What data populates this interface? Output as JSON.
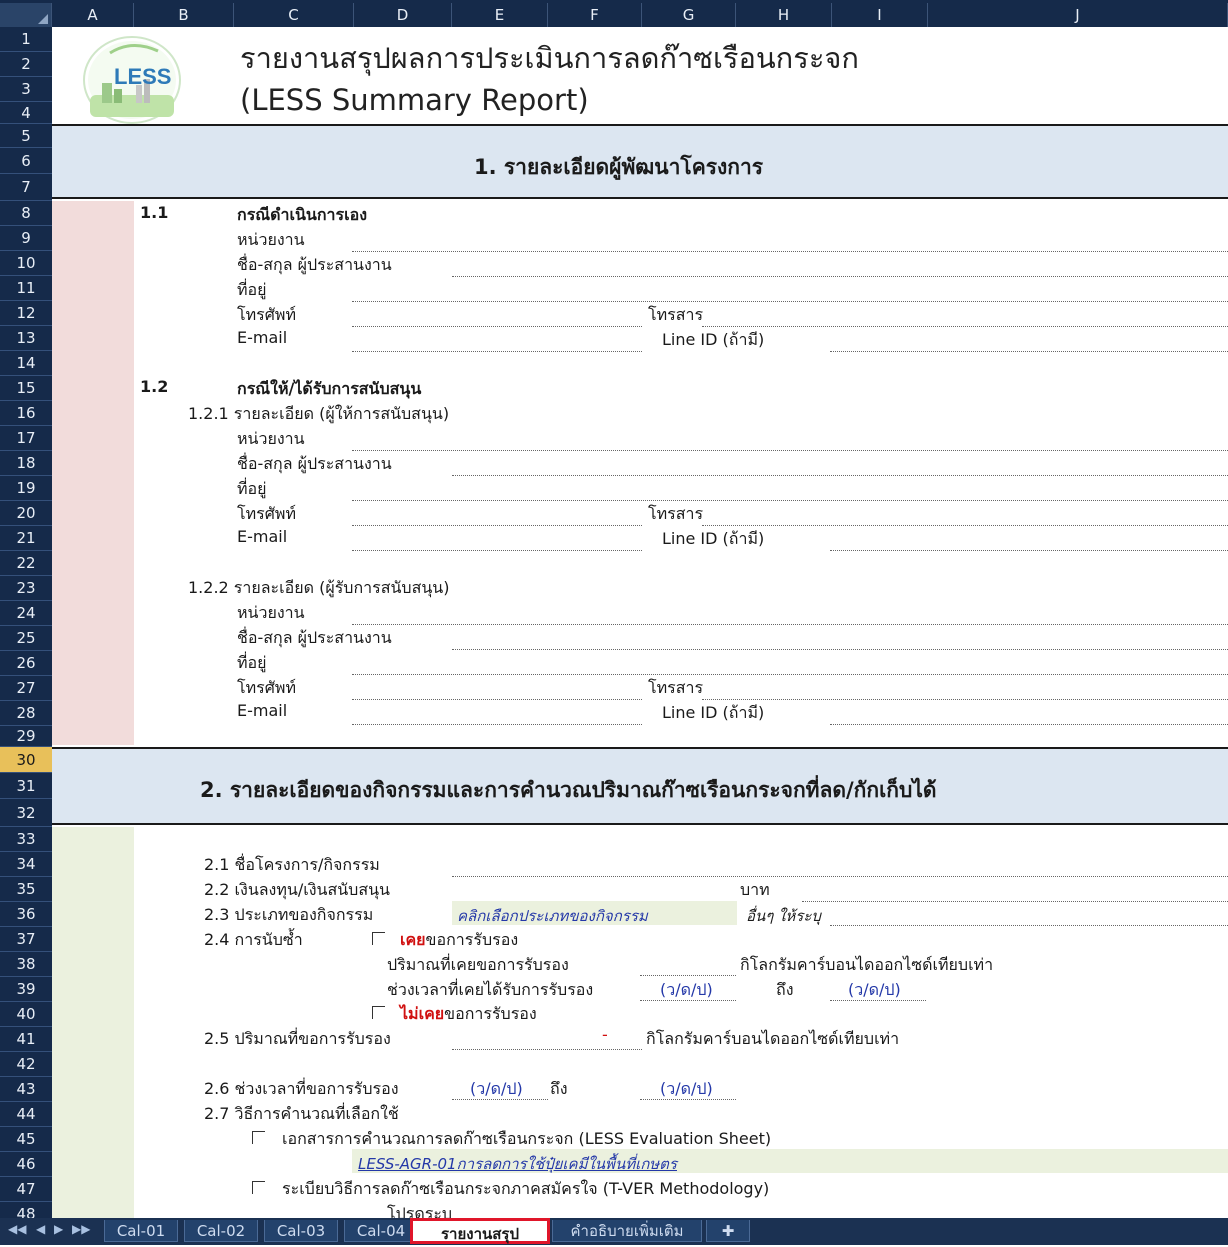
{
  "columns": [
    "A",
    "B",
    "C",
    "D",
    "E",
    "F",
    "G",
    "H",
    "I",
    "J"
  ],
  "rows": [
    "1",
    "2",
    "3",
    "4",
    "5",
    "6",
    "7",
    "8",
    "9",
    "10",
    "11",
    "12",
    "13",
    "14",
    "15",
    "16",
    "17",
    "18",
    "19",
    "20",
    "21",
    "22",
    "23",
    "24",
    "25",
    "26",
    "27",
    "28",
    "29",
    "30",
    "31",
    "32",
    "33",
    "34",
    "35",
    "36",
    "37",
    "38",
    "39",
    "40",
    "41",
    "42",
    "43",
    "44",
    "45",
    "46",
    "47",
    "48"
  ],
  "selected_row": "30",
  "logo": {
    "text": "LESS"
  },
  "title": {
    "line1": "รายงานสรุปผลการประเมินการลดก๊าซเรือนกระจก",
    "line2": "(LESS Summary Report)"
  },
  "section1": {
    "header": "1. รายละเอียดผู้พัฒนาโครงการ",
    "s11": {
      "num": "1.1",
      "title": "กรณีดำเนินการเอง",
      "agency": "หน่วยงาน",
      "coordinator": "ชื่อ-สกุล ผู้ประสานงาน",
      "address": "ที่อยู่",
      "phone": "โทรศัพท์",
      "fax": "โทรสาร",
      "email": "E-mail",
      "line": "Line ID (ถ้ามี)"
    },
    "s12": {
      "num": "1.2",
      "title": "กรณีให้/ได้รับการสนับสนุน",
      "s121": "1.2.1 รายละเอียด (ผู้ให้การสนับสนุน)",
      "s122": "1.2.2 รายละเอียด (ผู้รับการสนับสนุน)",
      "agency": "หน่วยงาน",
      "coordinator": "ชื่อ-สกุล ผู้ประสานงาน",
      "address": "ที่อยู่",
      "phone": "โทรศัพท์",
      "fax": "โทรสาร",
      "email": "E-mail",
      "line": "Line ID (ถ้ามี)"
    }
  },
  "section2": {
    "header": "2. รายละเอียดของกิจกรรมและการคำนวณปริมาณก๊าซเรือนกระจกที่ลด/กักเก็บได้",
    "i21": "2.1 ชื่อโครงการ/กิจกรรม",
    "i22": "2.2 เงินลงทุน/เงินสนับสนุน",
    "baht": "บาท",
    "i23": "2.3 ประเภทของกิจกรรม",
    "activity_type_value": "คลิกเลือกประเภทของกิจกรรม",
    "other_specify": "อื่นๆ ให้ระบุ",
    "i24": "2.4 การนับซ้ำ",
    "ever_red": "เคย",
    "ever_rest": "ขอการรับรอง",
    "ever_amount": "ปริมาณที่เคยขอการรับรอง",
    "kg_unit": "กิโลกรัมคาร์บอนไดออกไซด์เทียบเท่า",
    "ever_period": "ช่วงเวลาที่เคยได้รับการรับรอง",
    "date_fmt": "(ว/ด/ป)",
    "to": "ถึง",
    "never_red": "ไม่เคย",
    "never_rest": "ขอการรับรอง",
    "i25": "2.5 ปริมาณที่ขอการรับรอง",
    "dash": "-",
    "i26": "2.6 ช่วงเวลาที่ขอการรับรอง",
    "i27": "2.7 วิธีการคำนวณที่เลือกใช้",
    "method1": "เอกสารการคำนวณการลดก๊าซเรือนกระจก (LESS Evaluation Sheet)",
    "method1_value": "LESS-AGR-01การลดการใช้ปุ๋ยเคมีในพื้นที่เกษตร",
    "method2": "ระเบียบวิธีการลดก๊าซเรือนกระจกภาคสมัครใจ (T-VER Methodology)",
    "row48_text": "โปรดระบุ"
  },
  "tabs": [
    "Cal-01",
    "Cal-02",
    "Cal-03",
    "Cal-04",
    "รายงานสรุป",
    "คำอธิบายเพิ่มเติม"
  ],
  "active_tab": "รายงานสรุป",
  "colors": {
    "header_bg": "#152a4a",
    "section_band": "#dce6f1",
    "section1_side": "#f2dcdb",
    "section2_side": "#ebf1de",
    "selected_row": "#e8c05a",
    "active_tab_border": "#e0162a"
  }
}
